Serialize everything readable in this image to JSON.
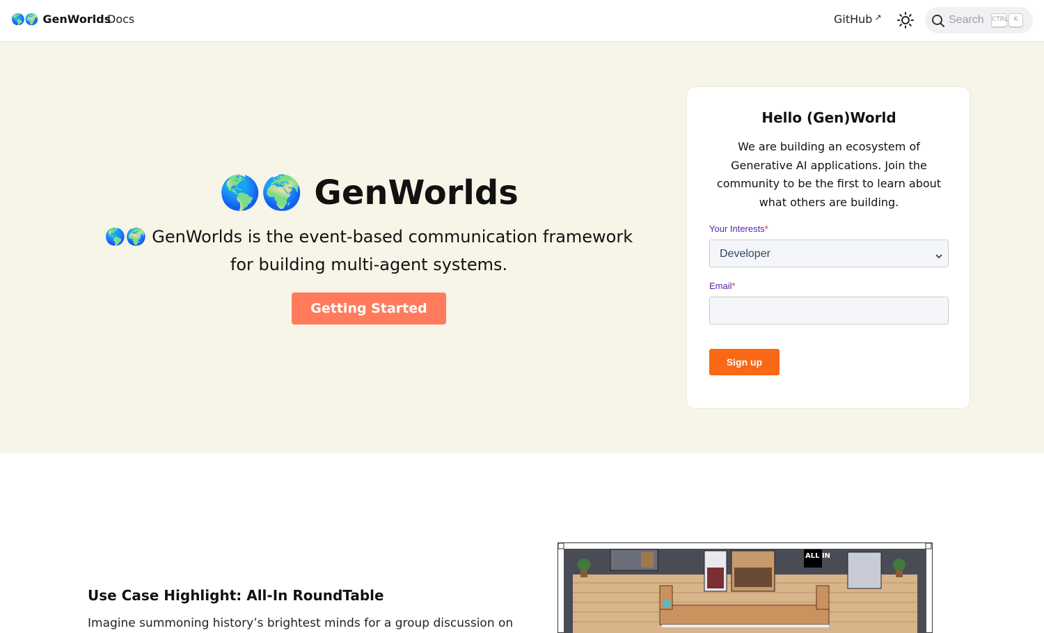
{
  "nav": {
    "brand": "🌎🌍 GenWorlds",
    "docs_label": "Docs",
    "github_label": "GitHub",
    "external_icon": "↗",
    "theme_icon": "sun-icon",
    "search_placeholder": "Search",
    "shortcut_keys": [
      "CTRL",
      "K"
    ]
  },
  "hero": {
    "title": "🌎🌍 GenWorlds",
    "subtitle": "🌎🌍 GenWorlds is the event-based communication framework for building multi-agent systems.",
    "cta_label": "Getting Started",
    "cta_color": "#ff7b5c",
    "background": "#f7f4e8"
  },
  "signup_card": {
    "title": "Hello (Gen)World",
    "text": "We are building an ecosystem of Generative AI applications. Join the community to be the first to learn about what others are building.",
    "interests_label": "Your Interests",
    "interests_value": "Developer",
    "email_label": "Email",
    "required_mark": "*",
    "submit_label": "Sign up",
    "submit_color": "#f96815"
  },
  "use_case": {
    "title": "Use Case Highlight: All-In RoundTable",
    "text": "Imagine summoning history’s brightest minds for a group discussion on",
    "game_sign": "ALL IN"
  }
}
